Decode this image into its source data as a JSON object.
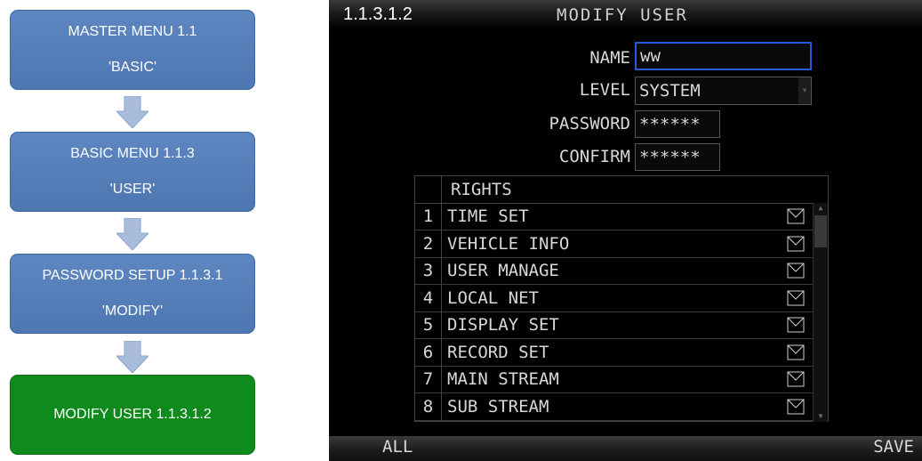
{
  "flow": {
    "steps": [
      {
        "line1": "MASTER MENU 1.1",
        "line2": "'BASIC'"
      },
      {
        "line1": "BASIC MENU 1.1.3",
        "line2": "'USER'"
      },
      {
        "line1": "PASSWORD SETUP 1.1.3.1",
        "line2": "'MODIFY'"
      },
      {
        "line1": "MODIFY USER 1.1.3.1.2"
      }
    ],
    "colors": {
      "step": "#5b84c0",
      "current": "#0f8a1c",
      "arrow": "#9db3d8"
    }
  },
  "screen": {
    "menu_code": "1.1.3.1.2",
    "title": "MODIFY USER",
    "form": {
      "name_label": "NAME",
      "name_value": "ww",
      "level_label": "LEVEL",
      "level_value": "SYSTEM",
      "password_label": "PASSWORD",
      "password_value": "******",
      "confirm_label": "CONFIRM",
      "confirm_value": "******"
    },
    "rights_header": "RIGHTS",
    "rights": [
      {
        "num": "1",
        "label": "TIME SET",
        "checked": true
      },
      {
        "num": "2",
        "label": "VEHICLE INFO",
        "checked": true
      },
      {
        "num": "3",
        "label": "USER MANAGE",
        "checked": true
      },
      {
        "num": "4",
        "label": "LOCAL NET",
        "checked": true
      },
      {
        "num": "5",
        "label": "DISPLAY SET",
        "checked": true
      },
      {
        "num": "6",
        "label": "RECORD SET",
        "checked": true
      },
      {
        "num": "7",
        "label": "MAIN STREAM",
        "checked": true
      },
      {
        "num": "8",
        "label": "SUB STREAM",
        "checked": true
      }
    ],
    "bottom": {
      "all_label": "ALL",
      "save_label": "SAVE"
    },
    "colors": {
      "focus_border": "#2a5ad8"
    }
  }
}
